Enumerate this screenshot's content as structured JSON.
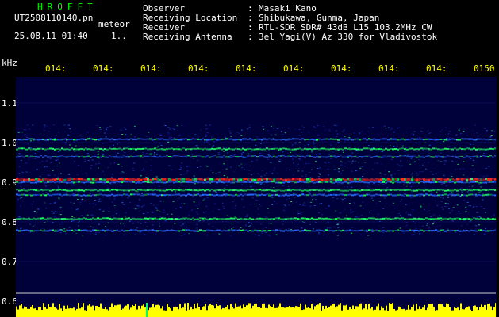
{
  "header": {
    "brand": "HROFFT",
    "filename": "UT2508110140.pn",
    "mode": "meteor",
    "datetime": "25.08.11 01:40",
    "counter": "1..",
    "info": [
      {
        "label": "Observer",
        "value": "Masaki Kano"
      },
      {
        "label": "Receiving Location",
        "value": "Shibukawa, Gunma, Japan"
      },
      {
        "label": "Receiver",
        "value": "RTL-SDR SDR# 43dB L15 103.2MHz CW"
      },
      {
        "label": "Receiving Antenna",
        "value": "3el Yagi(V) Az 330 for Vladivostok"
      }
    ]
  },
  "axes": {
    "y_unit": "kHz",
    "y_ticks": [
      "1.1",
      "1.0",
      "0.9",
      "0.8",
      "0.7",
      "0.6"
    ],
    "x_ticks": [
      "014:",
      "014:",
      "014:",
      "014:",
      "014:",
      "014:",
      "014:",
      "014:",
      "014:",
      "0150"
    ]
  },
  "colors": {
    "background": "#000000",
    "spectrogram_bg": "#00003a",
    "signal_band": "#2a6cff",
    "hot_band": "#ff2a1a",
    "green_noise": "#22ff66",
    "histogram": "#ffff00",
    "tick_color": "#ffff00",
    "grid": "#b0b0b0"
  }
}
